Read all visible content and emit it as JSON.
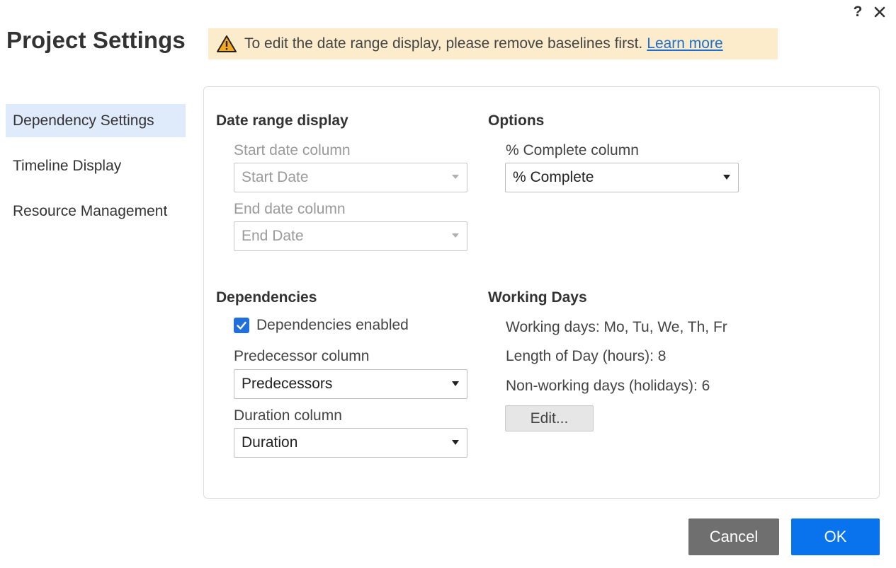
{
  "window": {
    "help_glyph": "?",
    "close_icon": "close-icon"
  },
  "header": {
    "title": "Project Settings"
  },
  "banner": {
    "icon": "warning-icon",
    "message": "To edit the date range display, please remove baselines first.",
    "link_label": "Learn more",
    "background": "#fdeccc"
  },
  "sidebar": {
    "items": [
      {
        "label": "Dependency Settings",
        "active": true
      },
      {
        "label": "Timeline Display",
        "active": false
      },
      {
        "label": "Resource Management",
        "active": false
      }
    ],
    "active_background": "#dfeafb"
  },
  "date_range": {
    "heading": "Date range display",
    "start_label": "Start date column",
    "start_value": "Start Date",
    "end_label": "End date column",
    "end_value": "End Date",
    "disabled": true
  },
  "options": {
    "heading": "Options",
    "complete_label": "% Complete column",
    "complete_value": "% Complete"
  },
  "dependencies": {
    "heading": "Dependencies",
    "enabled_label": "Dependencies enabled",
    "enabled": true,
    "predecessor_label": "Predecessor column",
    "predecessor_value": "Predecessors",
    "duration_label": "Duration column",
    "duration_value": "Duration"
  },
  "working_days": {
    "heading": "Working Days",
    "days_text": "Working days: Mo, Tu, We, Th, Fr",
    "length_text": "Length of Day (hours): 8",
    "holidays_text": "Non-working days (holidays): 6",
    "edit_label": "Edit..."
  },
  "footer": {
    "cancel_label": "Cancel",
    "ok_label": "OK",
    "ok_color": "#0873ec",
    "cancel_color": "#6f6f6f"
  }
}
